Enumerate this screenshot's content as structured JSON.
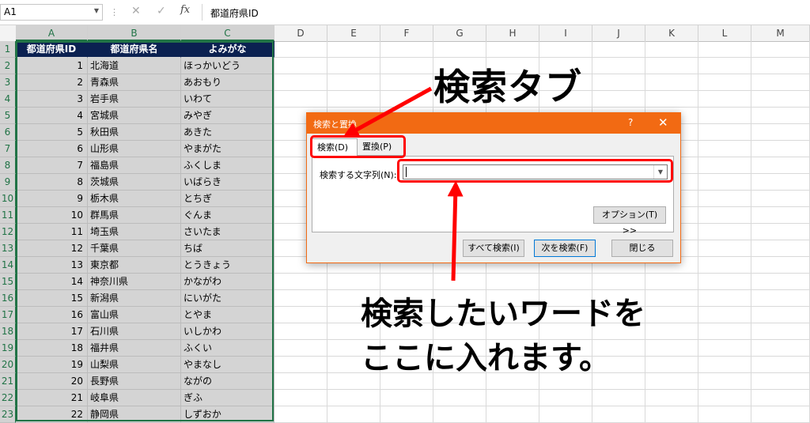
{
  "formula_bar": {
    "name_box": "A1",
    "cancel_glyph": "✕",
    "enter_glyph": "✓",
    "fx_label": "fx",
    "content": "都道府県ID"
  },
  "columns": [
    "A",
    "B",
    "C",
    "D",
    "E",
    "F",
    "G",
    "H",
    "I",
    "J",
    "K",
    "L",
    "M"
  ],
  "rows": [
    "1",
    "2",
    "3",
    "4",
    "5",
    "6",
    "7",
    "8",
    "9",
    "10",
    "11",
    "12",
    "13",
    "14",
    "15",
    "16",
    "17",
    "18",
    "19",
    "20",
    "21",
    "22",
    "23"
  ],
  "table": {
    "headers": [
      "都道府県ID",
      "都道府県名",
      "よみがな"
    ],
    "records": [
      [
        "1",
        "北海道",
        "ほっかいどう"
      ],
      [
        "2",
        "青森県",
        "あおもり"
      ],
      [
        "3",
        "岩手県",
        "いわて"
      ],
      [
        "4",
        "宮城県",
        "みやぎ"
      ],
      [
        "5",
        "秋田県",
        "あきた"
      ],
      [
        "6",
        "山形県",
        "やまがた"
      ],
      [
        "7",
        "福島県",
        "ふくしま"
      ],
      [
        "8",
        "茨城県",
        "いばらき"
      ],
      [
        "9",
        "栃木県",
        "とちぎ"
      ],
      [
        "10",
        "群馬県",
        "ぐんま"
      ],
      [
        "11",
        "埼玉県",
        "さいたま"
      ],
      [
        "12",
        "千葉県",
        "ちば"
      ],
      [
        "13",
        "東京都",
        "とうきょう"
      ],
      [
        "14",
        "神奈川県",
        "かながわ"
      ],
      [
        "15",
        "新潟県",
        "にいがた"
      ],
      [
        "16",
        "富山県",
        "とやま"
      ],
      [
        "17",
        "石川県",
        "いしかわ"
      ],
      [
        "18",
        "福井県",
        "ふくい"
      ],
      [
        "19",
        "山梨県",
        "やまなし"
      ],
      [
        "20",
        "長野県",
        "ながの"
      ],
      [
        "21",
        "岐阜県",
        "ぎふ"
      ],
      [
        "22",
        "静岡県",
        "しずおか"
      ]
    ]
  },
  "dialog": {
    "title": "検索と置換",
    "help": "?",
    "close": "✕",
    "tabs": [
      "検索(D)",
      "置換(P)"
    ],
    "find_label": "検索する文字列(N):",
    "find_value": "",
    "options_button": "オプション(T) >>",
    "find_all_button": "すべて検索(I)",
    "find_next_button": "次を検索(F)",
    "close_button": "閉じる"
  },
  "annotations": {
    "tab_callout": "検索タブ",
    "word_callout_line1": "検索したいワードを",
    "word_callout_line2": "ここに入れます。",
    "highlight_color": "#ff0000"
  },
  "colors": {
    "excel_green": "#217346",
    "header_fill": "#0b2151",
    "dialog_accent": "#f26a13"
  }
}
